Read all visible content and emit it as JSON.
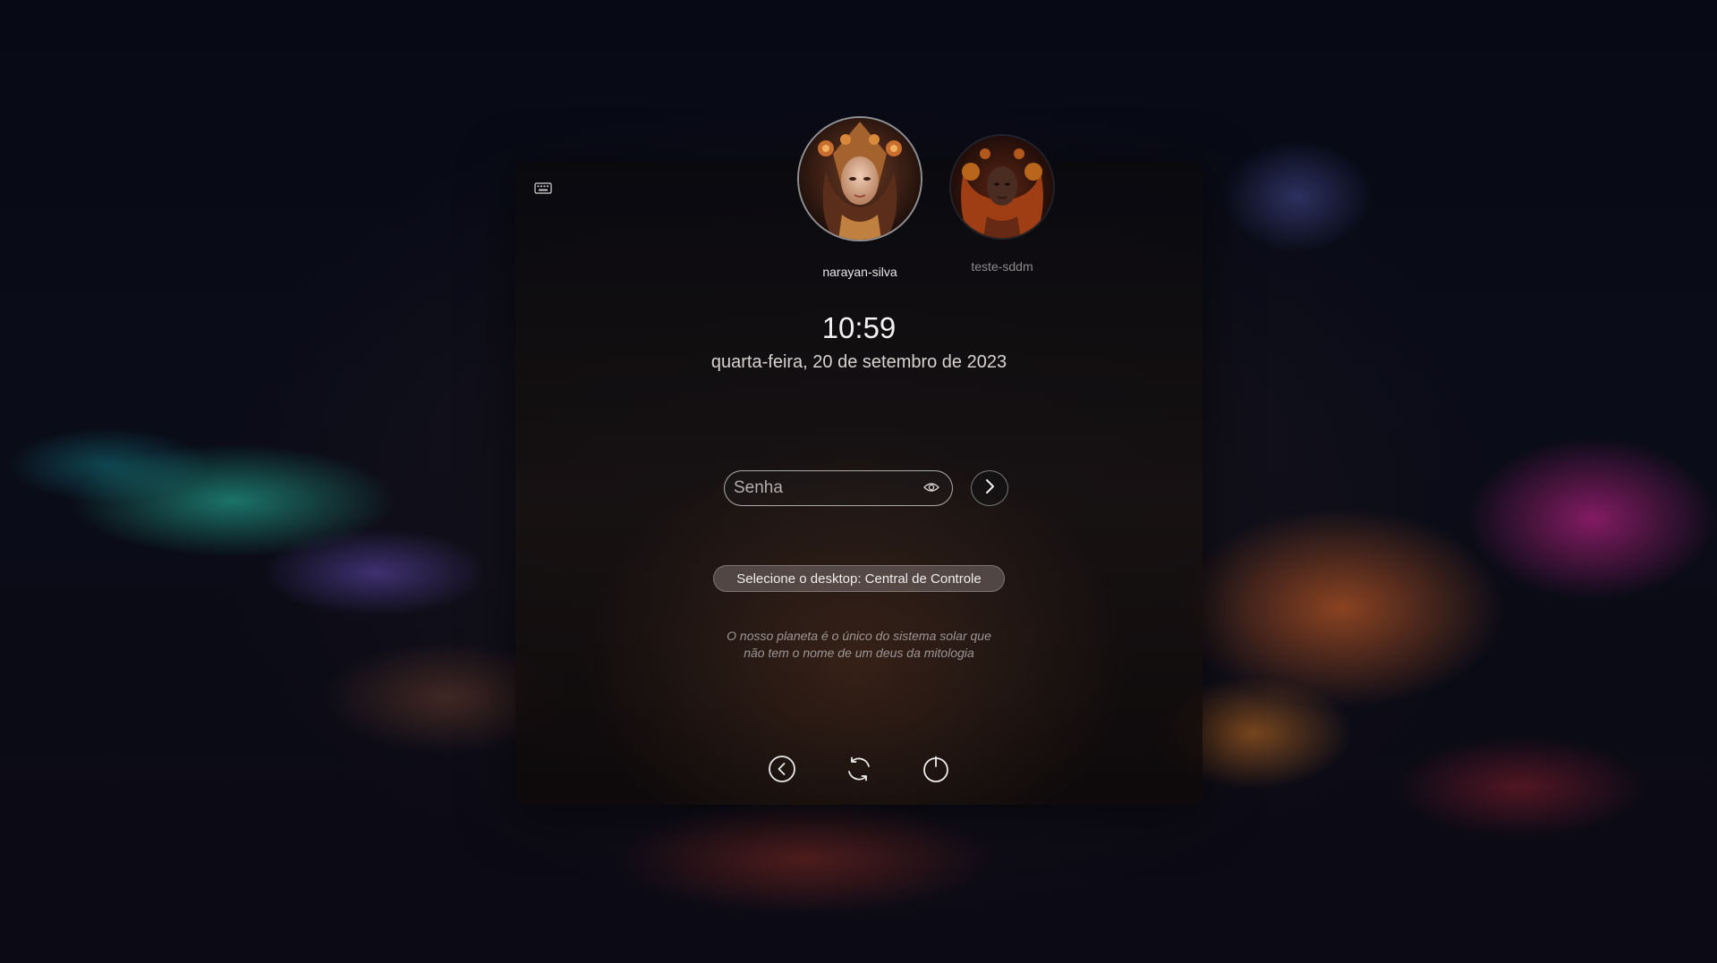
{
  "users": [
    {
      "name": "narayan-silva",
      "selected": true
    },
    {
      "name": "teste-sddm",
      "selected": false
    }
  ],
  "clock": {
    "time": "10:59",
    "date": "quarta-feira, 20 de setembro de 2023"
  },
  "password": {
    "placeholder": "Senha",
    "value": ""
  },
  "session": {
    "label": "Selecione o desktop: Central de Controle"
  },
  "quote": {
    "line1": "O nosso planeta é o único do sistema solar que",
    "line2": "não tem o nome de um deus da mitologia"
  },
  "icons": {
    "keyboard": "keyboard-icon",
    "eye": "eye-icon",
    "submit": "chevron-right-icon",
    "back": "chevron-left-circle-icon",
    "restart": "restart-icon",
    "power": "power-icon"
  },
  "colors": {
    "card_background": "#141012",
    "text_primary": "#f2f0f0",
    "text_muted": "#9c9594",
    "session_pill": "#786e6e"
  }
}
